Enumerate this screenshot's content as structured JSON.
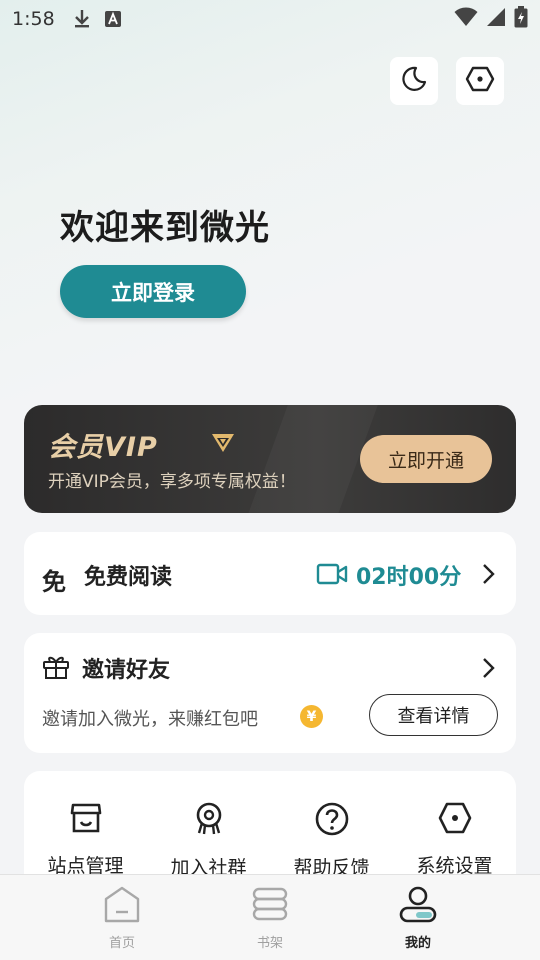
{
  "status_bar": {
    "time": "1:58"
  },
  "header": {
    "welcome_text": "欢迎来到微光",
    "login_label": "立即登录"
  },
  "vip": {
    "title": "会员VIP",
    "subtitle": "开通VIP会员，享多项专属权益！",
    "button_label": "立即开通"
  },
  "free_read": {
    "icon_text": "免",
    "title": "免费阅读",
    "time": "02时00分"
  },
  "invite": {
    "title": "邀请好友",
    "subtitle": "邀请加入微光，来赚红包吧",
    "coin_symbol": "¥",
    "detail_label": "查看详情"
  },
  "tools": [
    {
      "label": "站点管理",
      "icon": "store-icon"
    },
    {
      "label": "加入社群",
      "icon": "community-icon"
    },
    {
      "label": "帮助反馈",
      "icon": "help-icon"
    },
    {
      "label": "系统设置",
      "icon": "settings-icon"
    }
  ],
  "bottom_nav": [
    {
      "label": "首页",
      "icon": "home-icon",
      "active": false
    },
    {
      "label": "书架",
      "icon": "bookshelf-icon",
      "active": false
    },
    {
      "label": "我的",
      "icon": "profile-icon",
      "active": true
    }
  ],
  "colors": {
    "accent": "#1f8b93",
    "vip_gold": "#e8c398",
    "vip_bg": "#2c2b2b"
  }
}
